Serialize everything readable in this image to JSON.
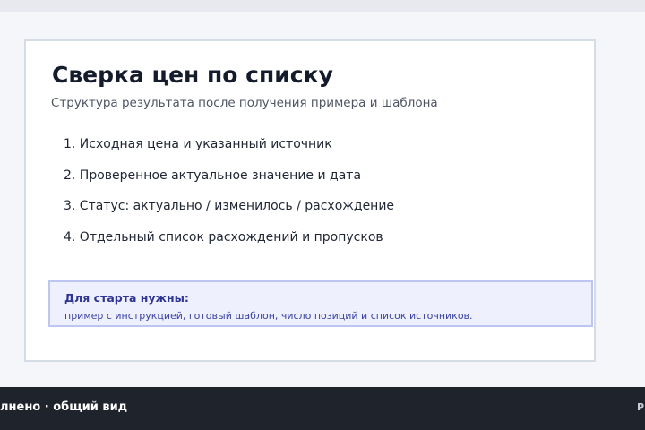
{
  "card": {
    "title": "Сверка цен по списку",
    "subtitle": "Структура результата после получения примера и шаблона",
    "steps": [
      "1. Исходная цена и указанный источник",
      "2. Проверенное актуальное значение и дата",
      "3. Статус: актуально / изменилось / расхождение",
      "4. Отдельный список расхождений и пропусков"
    ],
    "callout": {
      "title": "Для старта нужны:",
      "text": "пример с инструкцией, готовый шаблон, число позиций и список источников."
    }
  },
  "bottom_bar": {
    "left_text": "лнено · общий вид",
    "right_text": "Р"
  },
  "colors": {
    "page_background": "#f4f6fa",
    "card_background": "#ffffff",
    "card_border": "#d6dce6",
    "title_text": "#141c2c",
    "callout_background": "#eef0fd",
    "callout_border": "#bdc6f0",
    "callout_text": "#2f3596",
    "bottom_bar_background": "#1f232b"
  }
}
